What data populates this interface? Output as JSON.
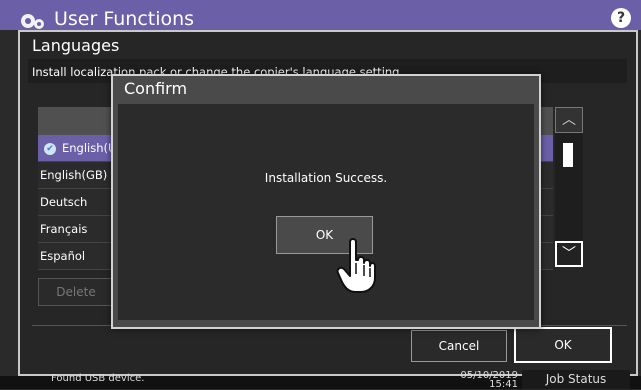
{
  "app": {
    "title": "User Functions",
    "help_label": "?"
  },
  "dialog": {
    "title": "Languages",
    "description": "Install localization pack or change the copier's language setting.",
    "languages": [
      {
        "label": "English(U",
        "selected": true
      },
      {
        "label": "English(GB)"
      },
      {
        "label": "Deutsch"
      },
      {
        "label": "Français"
      },
      {
        "label": "Español"
      }
    ],
    "delete_label": "Delete",
    "cancel_label": "Cancel",
    "ok_label": "OK"
  },
  "confirm": {
    "title": "Confirm",
    "message": "Installation Success.",
    "ok_label": "OK"
  },
  "status": {
    "message": "Found USB device.",
    "date": "05/10/2019",
    "time": "15:41",
    "job_status_label": "Job Status"
  },
  "colors": {
    "accent": "#6b5fa8",
    "background": "#2a2a2a"
  },
  "icons": [
    "gear-icon",
    "help-icon",
    "check-icon",
    "chevron-up-icon",
    "chevron-down-icon",
    "hand-pointer-icon"
  ]
}
